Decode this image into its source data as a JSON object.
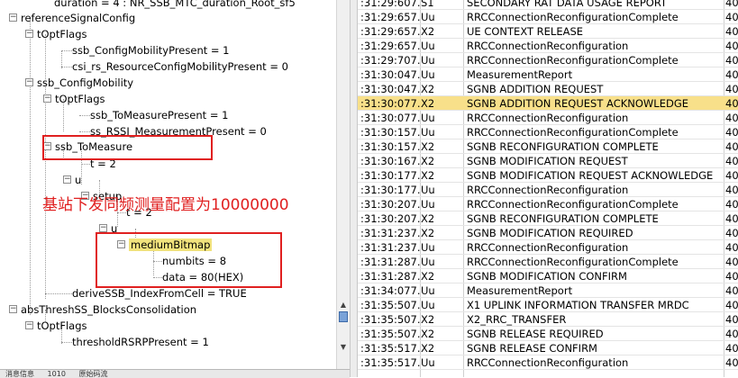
{
  "tree": {
    "nodes": [
      {
        "label": "duration = 4 : NR_SSB_MTC_duration_Root_sf5",
        "expander": ""
      },
      {
        "label": "referenceSignalConfig",
        "expander": "−"
      },
      {
        "label": "tOptFlags",
        "expander": "−"
      },
      {
        "label": "ssb_ConfigMobilityPresent = 1",
        "expander": ""
      },
      {
        "label": "csi_rs_ResourceConfigMobilityPresent = 0",
        "expander": ""
      },
      {
        "label": "ssb_ConfigMobility",
        "expander": "−"
      },
      {
        "label": "tOptFlags",
        "expander": "−"
      },
      {
        "label": "ssb_ToMeasurePresent = 1",
        "expander": ""
      },
      {
        "label": "ss_RSSI_MeasurementPresent = 0",
        "expander": ""
      },
      {
        "label": "ssb_ToMeasure",
        "expander": "−"
      },
      {
        "label": "t = 2",
        "expander": ""
      },
      {
        "label": "u",
        "expander": "−"
      },
      {
        "label": "setup",
        "expander": "−"
      },
      {
        "label": "t = 2",
        "expander": ""
      },
      {
        "label": "u",
        "expander": "−"
      },
      {
        "label": "mediumBitmap",
        "expander": "−"
      },
      {
        "label": "numbits = 8",
        "expander": ""
      },
      {
        "label": "data = 80(HEX)",
        "expander": ""
      },
      {
        "label": "deriveSSB_IndexFromCell = TRUE",
        "expander": ""
      },
      {
        "label": "absThreshSS_BlocksConsolidation",
        "expander": "−"
      },
      {
        "label": "tOptFlags",
        "expander": "−"
      },
      {
        "label": "thresholdRSRPPresent = 1",
        "expander": ""
      }
    ]
  },
  "annotation": "基站下发同频测量配置为10000000",
  "bottom_tabs": [
    "消息信息",
    "1010",
    "原始码流"
  ],
  "messages": [
    {
      "time": ":31:29:607...",
      "channel": "S1",
      "message": "SECONDARY RAT DATA USAGE REPORT",
      "extra": "40",
      "highlight": false
    },
    {
      "time": ":31:29:657...",
      "channel": "Uu",
      "message": "RRCConnectionReconfigurationComplete",
      "extra": "40",
      "highlight": false
    },
    {
      "time": ":31:29:657...",
      "channel": "X2",
      "message": "UE CONTEXT RELEASE",
      "extra": "40",
      "highlight": false
    },
    {
      "time": ":31:29:657...",
      "channel": "Uu",
      "message": "RRCConnectionReconfiguration",
      "extra": "40",
      "highlight": false
    },
    {
      "time": ":31:29:707...",
      "channel": "Uu",
      "message": "RRCConnectionReconfigurationComplete",
      "extra": "40",
      "highlight": false
    },
    {
      "time": ":31:30:047...",
      "channel": "Uu",
      "message": "MeasurementReport",
      "extra": "40",
      "highlight": false
    },
    {
      "time": ":31:30:047...",
      "channel": "X2",
      "message": "SGNB ADDITION REQUEST",
      "extra": "40",
      "highlight": false
    },
    {
      "time": ":31:30:077...",
      "channel": "X2",
      "message": "SGNB ADDITION REQUEST ACKNOWLEDGE",
      "extra": "40",
      "highlight": true
    },
    {
      "time": ":31:30:077...",
      "channel": "Uu",
      "message": "RRCConnectionReconfiguration",
      "extra": "40",
      "highlight": false
    },
    {
      "time": ":31:30:157...",
      "channel": "Uu",
      "message": "RRCConnectionReconfigurationComplete",
      "extra": "40",
      "highlight": false
    },
    {
      "time": ":31:30:157...",
      "channel": "X2",
      "message": "SGNB RECONFIGURATION COMPLETE",
      "extra": "40",
      "highlight": false
    },
    {
      "time": ":31:30:167...",
      "channel": "X2",
      "message": "SGNB MODIFICATION REQUEST",
      "extra": "40",
      "highlight": false
    },
    {
      "time": ":31:30:177...",
      "channel": "X2",
      "message": "SGNB MODIFICATION REQUEST ACKNOWLEDGE",
      "extra": "40",
      "highlight": false
    },
    {
      "time": ":31:30:177...",
      "channel": "Uu",
      "message": "RRCConnectionReconfiguration",
      "extra": "40",
      "highlight": false
    },
    {
      "time": ":31:30:207...",
      "channel": "Uu",
      "message": "RRCConnectionReconfigurationComplete",
      "extra": "40",
      "highlight": false
    },
    {
      "time": ":31:30:207...",
      "channel": "X2",
      "message": "SGNB RECONFIGURATION COMPLETE",
      "extra": "40",
      "highlight": false
    },
    {
      "time": ":31:31:237...",
      "channel": "X2",
      "message": "SGNB MODIFICATION REQUIRED",
      "extra": "40",
      "highlight": false
    },
    {
      "time": ":31:31:237...",
      "channel": "Uu",
      "message": "RRCConnectionReconfiguration",
      "extra": "40",
      "highlight": false
    },
    {
      "time": ":31:31:287...",
      "channel": "Uu",
      "message": "RRCConnectionReconfigurationComplete",
      "extra": "40",
      "highlight": false
    },
    {
      "time": ":31:31:287...",
      "channel": "X2",
      "message": "SGNB MODIFICATION CONFIRM",
      "extra": "40",
      "highlight": false
    },
    {
      "time": ":31:34:077...",
      "channel": "Uu",
      "message": "MeasurementReport",
      "extra": "40",
      "highlight": false
    },
    {
      "time": ":31:35:507...",
      "channel": "Uu",
      "message": "X1 UPLINK INFORMATION TRANSFER MRDC",
      "extra": "40",
      "highlight": false
    },
    {
      "time": ":31:35:507...",
      "channel": "X2",
      "message": "X2_RRC_TRANSFER",
      "extra": "40",
      "highlight": false
    },
    {
      "time": ":31:35:507...",
      "channel": "X2",
      "message": "SGNB RELEASE REQUIRED",
      "extra": "40",
      "highlight": false
    },
    {
      "time": ":31:35:517...",
      "channel": "X2",
      "message": "SGNB RELEASE CONFIRM",
      "extra": "40",
      "highlight": false
    },
    {
      "time": ":31:35:517...",
      "channel": "Uu",
      "message": "RRCConnectionReconfiguration",
      "extra": "40",
      "highlight": false
    }
  ],
  "colors": {
    "highlight_row": "#f8e08a",
    "selected_label": "#f1e27c",
    "annotation_red": "#e02020",
    "scroll_thumb": "#7aa3d8"
  }
}
